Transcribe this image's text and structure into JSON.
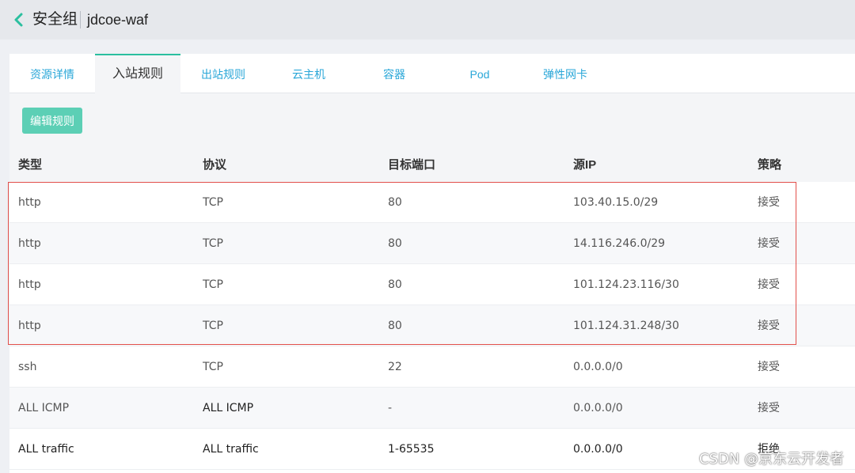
{
  "header": {
    "title": "安全组",
    "name": "jdcoe-waf"
  },
  "tabs": [
    {
      "label": "资源详情",
      "active": false
    },
    {
      "label": "入站规则",
      "active": true
    },
    {
      "label": "出站规则",
      "active": false
    },
    {
      "label": "云主机",
      "active": false
    },
    {
      "label": "容器",
      "active": false
    },
    {
      "label": "Pod",
      "active": false
    },
    {
      "label": "弹性网卡",
      "active": false
    }
  ],
  "toolbar": {
    "edit_label": "编辑规则"
  },
  "table": {
    "columns": [
      "类型",
      "协议",
      "目标端口",
      "源IP",
      "策略"
    ],
    "rows": [
      [
        "http",
        "TCP",
        "80",
        "103.40.15.0/29",
        "接受"
      ],
      [
        "http",
        "TCP",
        "80",
        "14.116.246.0/29",
        "接受"
      ],
      [
        "http",
        "TCP",
        "80",
        "101.124.23.116/30",
        "接受"
      ],
      [
        "http",
        "TCP",
        "80",
        "101.124.31.248/30",
        "接受"
      ],
      [
        "ssh",
        "TCP",
        "22",
        "0.0.0.0/0",
        "接受"
      ],
      [
        "ALL ICMP",
        "ALL ICMP",
        "-",
        "0.0.0.0/0",
        "接受"
      ],
      [
        "ALL traffic",
        "ALL traffic",
        "1-65535",
        "0.0.0.0/0",
        "拒绝"
      ]
    ]
  },
  "watermark": "CSDN @京东云开发者",
  "colors": {
    "accent": "#2bbf9f",
    "link": "#2aa7d8",
    "button": "#5ccfb5",
    "highlight": "#e2504b"
  }
}
